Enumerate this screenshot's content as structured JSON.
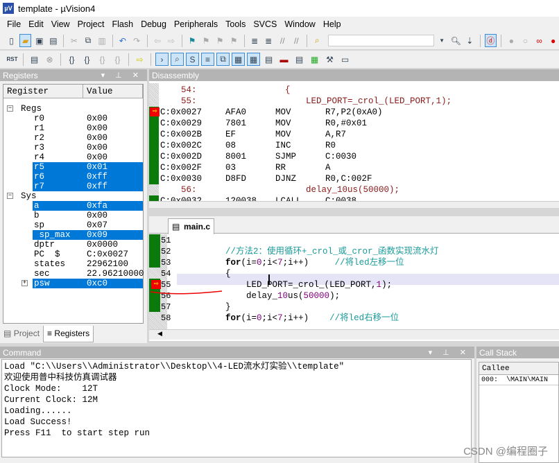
{
  "window": {
    "title": "template  - µVision4"
  },
  "menu": [
    "File",
    "Edit",
    "View",
    "Project",
    "Flash",
    "Debug",
    "Peripherals",
    "Tools",
    "SVCS",
    "Window",
    "Help"
  ],
  "toolbar1": [
    "new-file-icon",
    "open-folder-icon",
    "save-icon",
    "save-all-icon",
    "cut-icon",
    "copy-icon",
    "paste-icon",
    "undo-icon",
    "redo-icon",
    "back-icon",
    "forward-icon",
    "bookmark-icon",
    "prev-bookmark-icon",
    "next-bookmark-icon",
    "clear-bookmarks-icon",
    "indent-icon",
    "unindent-icon",
    "comment-icon",
    "uncomment-icon",
    "find-in-files-icon"
  ],
  "toolbar2": {
    "rst_label": "RST"
  },
  "registers": {
    "title": "Registers",
    "col_register": "Register",
    "col_value": "Value",
    "rows": [
      {
        "name": "Regs",
        "value": "",
        "group": true
      },
      {
        "name": "r0",
        "value": "0x00"
      },
      {
        "name": "r1",
        "value": "0x00"
      },
      {
        "name": "r2",
        "value": "0x00"
      },
      {
        "name": "r3",
        "value": "0x00"
      },
      {
        "name": "r4",
        "value": "0x00"
      },
      {
        "name": "r5",
        "value": "0x01",
        "selected": true
      },
      {
        "name": "r6",
        "value": "0xff",
        "selected": true
      },
      {
        "name": "r7",
        "value": "0xff",
        "selected": true
      },
      {
        "name": "Sys",
        "value": "",
        "group": true
      },
      {
        "name": "a",
        "value": "0xfa",
        "selected": true
      },
      {
        "name": "b",
        "value": "0x00"
      },
      {
        "name": "sp",
        "value": "0x07"
      },
      {
        "name": " sp_max",
        "value": "0x09",
        "selected": true
      },
      {
        "name": "dptr",
        "value": "0x0000"
      },
      {
        "name": "PC  $",
        "value": "C:0x0027"
      },
      {
        "name": "states",
        "value": "22962100"
      },
      {
        "name": "sec",
        "value": "22.96210000"
      },
      {
        "name": "psw",
        "value": "0xc0",
        "selected": true
      }
    ],
    "tabs": [
      "Project",
      "Registers"
    ]
  },
  "disassembly": {
    "title": "Disassembly",
    "lines": [
      {
        "src": "    54:                 {"
      },
      {
        "src": "    55:                     LED_PORT=_crol_(LED_PORT,1);"
      },
      {
        "addr": "C:0x0027",
        "code": "AFA0",
        "op": "MOV",
        "args": "R7,P2(0xA0)",
        "current": true
      },
      {
        "addr": "C:0x0029",
        "code": "7801",
        "op": "MOV",
        "args": "R0,#0x01"
      },
      {
        "addr": "C:0x002B",
        "code": "EF",
        "op": "MOV",
        "args": "A,R7"
      },
      {
        "addr": "C:0x002C",
        "code": "08",
        "op": "INC",
        "args": "R0"
      },
      {
        "addr": "C:0x002D",
        "code": "8001",
        "op": "SJMP",
        "args": "C:0030"
      },
      {
        "addr": "C:0x002F",
        "code": "03",
        "op": "RR",
        "args": "A"
      },
      {
        "addr": "C:0x0030",
        "code": "D8FD",
        "op": "DJNZ",
        "args": "R0,C:002F"
      },
      {
        "src": "    56:                     delay_10us(50000);"
      },
      {
        "addr": "C:0x0032",
        "code": "120038",
        "op": "LCALL",
        "args": "C:0038"
      }
    ]
  },
  "editor": {
    "tab": "main.c",
    "lines": [
      {
        "n": "51",
        "text": ""
      },
      {
        "n": "52",
        "text": "//方法2：使用循环+_crol_或_cror_函数实现流水灯"
      },
      {
        "n": "53",
        "text": "for(i=0;i<7;i++)     //将led左移一位"
      },
      {
        "n": "54",
        "text": "{"
      },
      {
        "n": "55",
        "text": "    LED_PORT=_crol_(LED_PORT,1);"
      },
      {
        "n": "56",
        "text": "    delay_10us(50000);"
      },
      {
        "n": "57",
        "text": "}"
      },
      {
        "n": "58",
        "text": "for(i=0;i<7;i++)    //将led右移一位"
      }
    ]
  },
  "command": {
    "title": "Command",
    "lines": [
      "Load \"C:\\\\Users\\\\Administrator\\\\Desktop\\\\4-LED流水灯实验\\\\template\"",
      "欢迎使用普中科技仿真调试器",
      "Clock Mode:    12T",
      "Current Clock: 12M",
      "Loading......",
      "Load Success!",
      "Press F11  to start step run"
    ]
  },
  "callstack": {
    "title": "Call Stack",
    "col": "Callee",
    "rows": [
      "000:  \\MAIN\\MAIN"
    ]
  },
  "watermark": "CSDN @编程圈子",
  "colors": {
    "selection": "#0078d7",
    "exec_green": "#0a7a0a",
    "comment": "#1a9a9a",
    "disasm_src": "#8b1a1a"
  }
}
